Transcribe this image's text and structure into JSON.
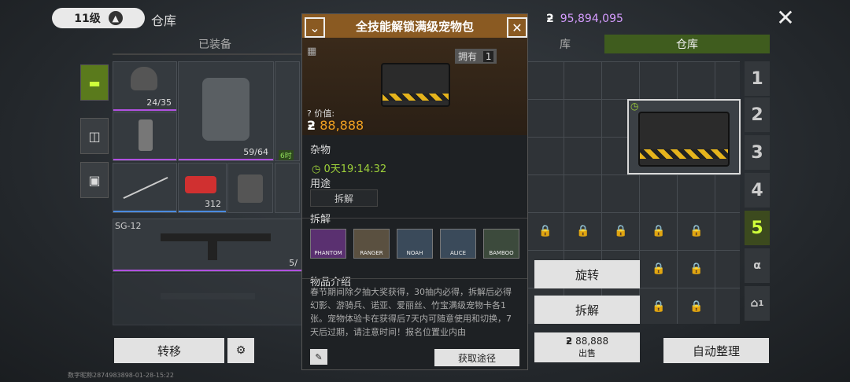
{
  "topbar": {
    "level": "11级",
    "title": "仓库",
    "currency": "95,894,095"
  },
  "tabs": {
    "equipped": "已装备",
    "middle": "库",
    "warehouse": "仓库"
  },
  "slots": {
    "helmet_dur": "24/35",
    "armor_dur": "59/64",
    "med_count": "312",
    "weapon_name": "SG-12",
    "weapon_ammo": "5/",
    "time_badge": "6时"
  },
  "grid_pages": [
    "1",
    "2",
    "3",
    "4",
    "5"
  ],
  "side_extra": {
    "house_num": "1"
  },
  "popup": {
    "title": "全技能解锁满级宠物包",
    "owned_label": "拥有",
    "owned_count": "1",
    "value_label": "价值:",
    "value": "88,888",
    "category": "杂物",
    "timer": "0天19:14:32",
    "usage_label": "用途",
    "usage_value": "拆解",
    "dismantle_label": "拆解",
    "dismantle_items": [
      "PHANTOM",
      "RANGER",
      "NOAH",
      "ALICE",
      "BAMBOO"
    ],
    "intro_label": "物品介绍",
    "intro_text": "春节期间除夕抽大奖获得，30抽内必得，拆解后必得幻影、游骑兵、诺亚、爱丽丝、竹宝满级宠物卡各1张。宠物体验卡在获得后7天内可随意使用和切换，7天后过期，请注意时间！报名位置业内由",
    "source_button": "获取途径"
  },
  "actions": {
    "rotate": "旋转",
    "dismantle": "拆解",
    "sell_price": "88,888",
    "sell": "出售",
    "auto_sort": "自动整理",
    "transfer": "转移"
  },
  "footer": {
    "watermark": "数字昵称2874983898-01-28-15:22"
  },
  "colors": {
    "accent_green": "#5a7a1c",
    "popup_header": "#8a5a22",
    "price": "#f0a020",
    "timer": "#9fd23a"
  }
}
